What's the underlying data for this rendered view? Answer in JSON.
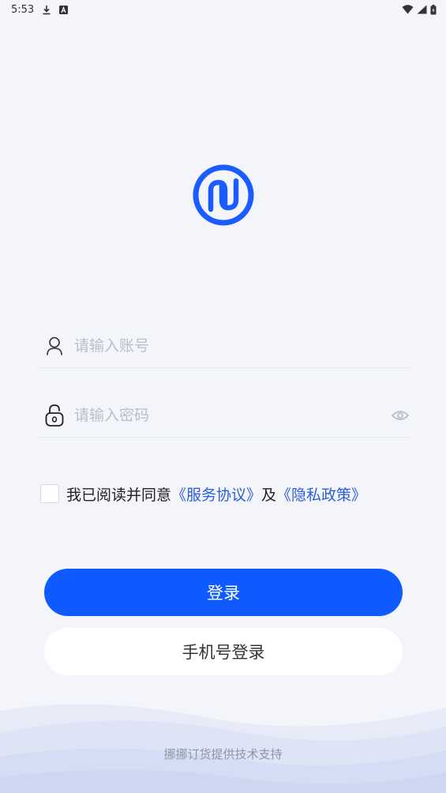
{
  "status_bar": {
    "time": "5:53",
    "icons": [
      "download-icon",
      "a-notification-icon",
      "wifi-icon",
      "signal-icon",
      "battery-icon"
    ]
  },
  "logo": {
    "icon": "nuo-logo-icon",
    "color": "#1a5cff"
  },
  "form": {
    "account": {
      "icon": "user-icon",
      "value": "",
      "placeholder": "请输入账号"
    },
    "password": {
      "icon": "lock-icon",
      "value": "",
      "placeholder": "请输入密码",
      "toggle_icon": "eye-icon"
    }
  },
  "agreement": {
    "checked": false,
    "text": "我已阅读并同意",
    "terms_link": "《服务协议》",
    "and_text": "及",
    "privacy_link": "《隐私政策》"
  },
  "buttons": {
    "login_label": "登录",
    "phone_login_label": "手机号登录"
  },
  "footer": {
    "text": "挪挪订货提供技术支持"
  },
  "colors": {
    "primary": "#0f5bff",
    "link": "#2b5ed8",
    "background": "#f3f5fa",
    "placeholder": "#b9bec7"
  }
}
